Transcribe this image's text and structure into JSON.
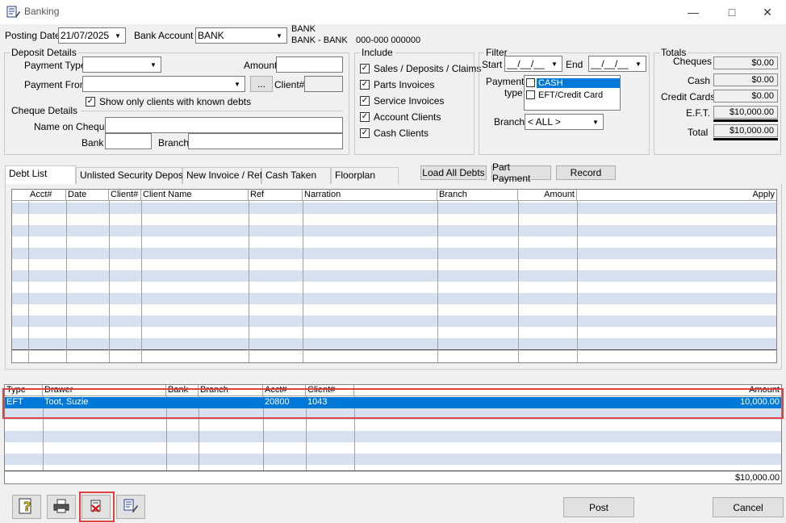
{
  "window": {
    "title": "Banking"
  },
  "header": {
    "posting_date_label": "Posting Date",
    "posting_date": "21/07/2025",
    "bank_account_label": "Bank Account",
    "bank_account": "BANK",
    "bank_name_line1": "BANK",
    "bank_name_line2": "BANK - BANK",
    "bank_numbers": "000-000  000000"
  },
  "deposit": {
    "legend": "Deposit Details",
    "payment_type_label": "Payment Type",
    "payment_type": "",
    "amount_label": "Amount",
    "amount": "",
    "payment_from_label": "Payment From",
    "payment_from": "",
    "ellipsis": "...",
    "client_label": "Client#",
    "client": "",
    "known_debts_label": "Show only clients with known debts",
    "known_debts_checked": true,
    "cheque_legend": "Cheque Details",
    "name_on_cheque_label": "Name on Cheque",
    "bank_label": "Bank",
    "branch_label": "Branch"
  },
  "include": {
    "legend": "Include",
    "items": [
      {
        "label": "Sales / Deposits / Claims",
        "checked": true
      },
      {
        "label": "Parts Invoices",
        "checked": true
      },
      {
        "label": "Service Invoices",
        "checked": true
      },
      {
        "label": "Account Clients",
        "checked": true
      },
      {
        "label": "Cash Clients",
        "checked": true
      }
    ]
  },
  "filter": {
    "legend": "Filter",
    "start_label": "Start",
    "start": "__/__/__",
    "end_label": "End",
    "end": "__/__/__",
    "payment_label": "Payment",
    "type_label": "type",
    "payment_types": [
      "CASH",
      "EFT/Credit Card"
    ],
    "branch_label": "Branch",
    "branch": "< ALL >"
  },
  "totals": {
    "legend": "Totals",
    "cheques_label": "Cheques",
    "cheques": "$0.00",
    "cash_label": "Cash",
    "cash": "$0.00",
    "credit_label": "Credit Cards",
    "credit": "$0.00",
    "eft_label": "E.F.T.",
    "eft": "$10,000.00",
    "total_label": "Total",
    "total": "$10,000.00"
  },
  "tabs": [
    "Debt List",
    "Unlisted Security Deposit",
    "New Invoice / Ref",
    "Cash Taken",
    "Floorplan"
  ],
  "actions": {
    "load_all": "Load All Debts",
    "part_payment": "Part Payment",
    "record": "Record"
  },
  "debt_grid": {
    "headers": [
      "Acct#",
      "Date",
      "Client#",
      "Client Name",
      "Ref",
      "Narration",
      "Branch",
      "Amount",
      "Apply"
    ]
  },
  "pay_grid": {
    "headers": [
      "Type",
      "Drawer",
      "Bank",
      "Branch",
      "Acct#",
      "Client#",
      "Amount"
    ],
    "rows": [
      {
        "type": "EFT",
        "drawer": "Toot, Suzie",
        "bank": "",
        "branch": "",
        "acct": "20800",
        "client": "1043",
        "amount": "10,000.00"
      }
    ],
    "footer_total": "$10,000.00"
  },
  "footer": {
    "post": "Post",
    "cancel": "Cancel"
  },
  "colors": {
    "selection": "#0078d7",
    "alt_row": "#d6e0ef",
    "highlight": "#e04040"
  }
}
